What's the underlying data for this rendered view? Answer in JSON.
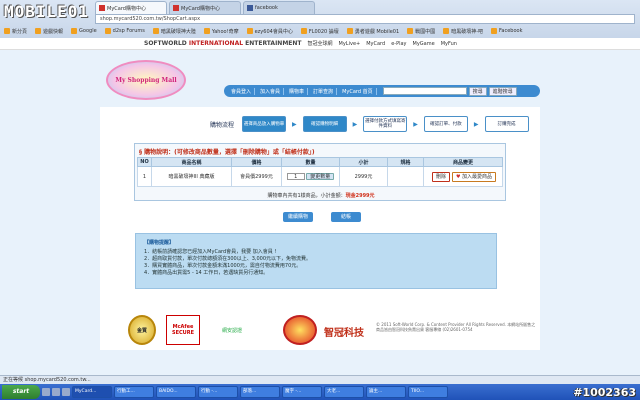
{
  "watermark": {
    "site": "MOBILE01",
    "id": "#1002363"
  },
  "browser": {
    "tabs": [
      {
        "label": "MyCard購物中心",
        "active": true
      },
      {
        "label": "MyCard購物中心",
        "active": false
      },
      {
        "label": "facebook",
        "active": false
      }
    ],
    "address": "shop.mycard520.com.tw/ShopCart.aspx",
    "bookmarks": [
      "新分頁",
      "遊戲快報",
      "Google",
      "d2sp Forums",
      "暗黑破壞神大陸",
      "Yahoo!奇摩",
      "ezy604會員中心",
      "FL0020 論壇",
      "勇者遊戲 Mobile01",
      "戰國中國",
      "暗黑破壞神-吧",
      "Facebook"
    ]
  },
  "sw_bar": {
    "logo_prefix": "SOFTWORLD ",
    "logo_accent": "INTERNATIONAL",
    "logo_suffix": " ENTERTAINMENT",
    "links": [
      "智冠全球網",
      "MyLive+",
      "MyCard",
      "e-Play",
      "MyGame",
      "MyFun"
    ]
  },
  "banner": {
    "mall_logo": "My Shopping Mall",
    "nav": [
      "會員登入",
      "加入會員",
      "購物車",
      "訂單查詢",
      "MyCard 首頁"
    ],
    "search_button": "搜尋",
    "advanced_button": "進階搜尋"
  },
  "steps": {
    "title": "購物流程",
    "items": [
      {
        "label": "選擇商品放入購物車",
        "active": true
      },
      {
        "label": "確認購物明細",
        "active": true
      },
      {
        "label": "選擇付款方式填寫寄件資料",
        "active": false
      },
      {
        "label": "確認訂單、付款",
        "active": false
      },
      {
        "label": "訂購完成",
        "active": false
      }
    ]
  },
  "cart": {
    "title": "§ 購物說明：(可修改商品數量，選擇「刪除購物」或「結帳付款」)",
    "headers": [
      "NO",
      "商品名稱",
      "價格",
      "數量",
      "小計",
      "規格",
      "商品變更"
    ],
    "rows": [
      {
        "no": "1",
        "name": "暗黑破壞神III 典藏版",
        "price": "會員價2999元",
        "qty": "1",
        "update": "變更數量",
        "subtotal": "2999元",
        "spec": "",
        "delete": "刪除",
        "favorite": "加入最愛商品"
      }
    ],
    "total": "購物車內共有1樣商品，小計金額：",
    "total_amount": "現金2999元"
  },
  "buttons": {
    "continue": "繼續購物",
    "checkout": "結帳"
  },
  "notes": {
    "title": "【購物提醒】",
    "lines": [
      "1．結帳前請確認您已經加入MyCard會員，我要 加入會員 !",
      "2．超商取貨付款，單次付款總額須在300以上、3,000元以下，免物流費。",
      "3．購買實體商品，單次付款金額未滿1000元，需自付物流費用70元。",
      "4．實體商品出貨需5 - 14 工作日，若遇缺貨另行通知。"
    ]
  },
  "footer": {
    "gold": "金質",
    "mcafee_1": "McAfee",
    "mcafee_2": "SECURE",
    "cert": "網安認證",
    "brand": "智冠科技",
    "copyright": "© 2011 Soft-World Corp. & Content Provider All Rights Reserved. 本網站所販售之商品皆由智冠科技負責出貨 客服專線 (02)2601-0754"
  },
  "status_text": "正在等候 shop.mycard520.com.tw...",
  "taskbar": {
    "start": "start",
    "items": [
      "MyCard...",
      "行動工...",
      "BAIDO...",
      "行動 -...",
      "部落...",
      "魔字 -...",
      "大老...",
      "論主...",
      "TIIO..."
    ]
  }
}
